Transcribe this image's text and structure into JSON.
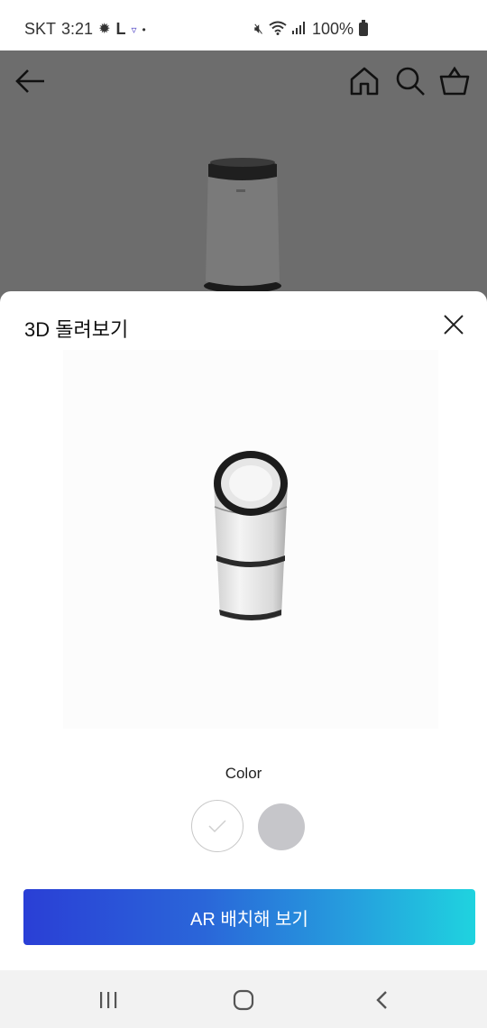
{
  "status_bar": {
    "carrier": "SKT",
    "time": "3:21",
    "indicator_l": "L",
    "dot": "•",
    "battery": "100%"
  },
  "background": {
    "nav_icons": [
      "back-arrow-icon",
      "home-icon",
      "search-icon",
      "shopping-bag-icon"
    ]
  },
  "sheet": {
    "title": "3D 돌려보기",
    "color_label": "Color",
    "swatches": [
      {
        "name": "white",
        "color": "#ffffff",
        "selected": true
      },
      {
        "name": "gray",
        "color": "#c6c6ca",
        "selected": false
      }
    ],
    "ar_button_label": "AR 배치해 보기"
  },
  "colors": {
    "accent_start": "#2a3fd6",
    "accent_end": "#1fd3df",
    "dim_overlay": "#6d6d6d"
  }
}
